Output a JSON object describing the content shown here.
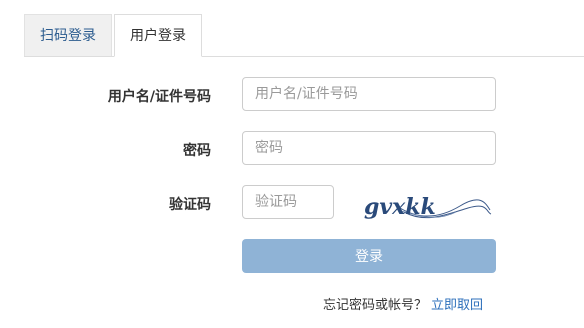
{
  "tabs": [
    {
      "label": "扫码登录",
      "active": false
    },
    {
      "label": "用户登录",
      "active": true
    }
  ],
  "form": {
    "username": {
      "label": "用户名/证件号码",
      "placeholder": "用户名/证件号码",
      "value": ""
    },
    "password": {
      "label": "密码",
      "placeholder": "密码",
      "value": ""
    },
    "captcha": {
      "label": "验证码",
      "placeholder": "验证码",
      "value": "",
      "image_text": "gvxkk"
    },
    "submit_label": "登录"
  },
  "footer": {
    "forgot_text": "忘记密码或帐号？",
    "recover_link": "立即取回"
  },
  "colors": {
    "accent": "#2c6fbb",
    "button": "#8fb3d6",
    "tab_inactive_bg": "#f0f0f0"
  }
}
